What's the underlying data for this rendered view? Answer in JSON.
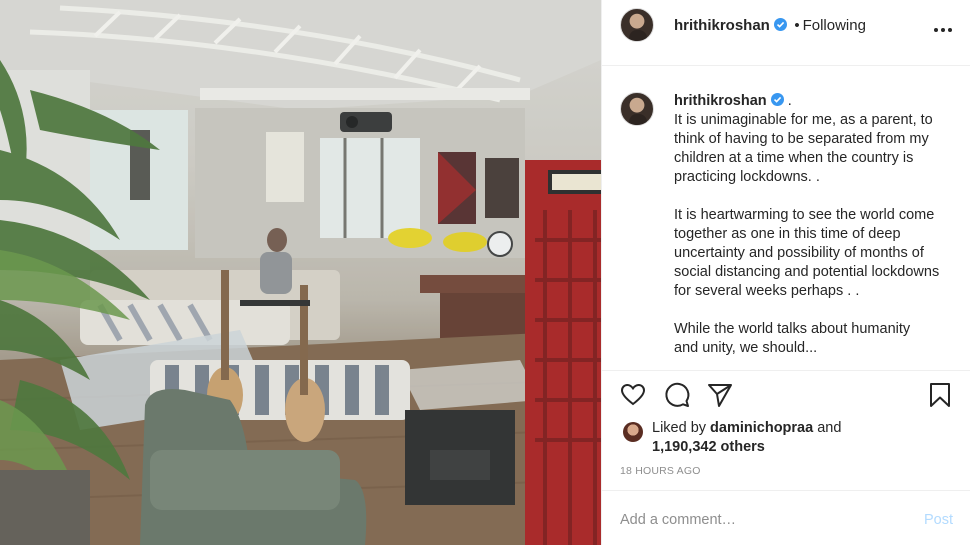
{
  "post": {
    "username": "hrithikroshan",
    "follow_status": "Following",
    "separator": "•",
    "more_icon": "more-horizontal-icon",
    "verified_icon": "verified-badge-icon"
  },
  "caption": {
    "username": "hrithikroshan",
    "suffix": ".",
    "text": "It is unimaginable for me, as a parent, to think of having to be separated from my children at a time when the country is practicing lockdowns. .\n\nIt is heartwarming to see the world come together as one in this time of deep uncertainty and possibility of months of social distancing and potential lockdowns for several weeks perhaps . .\n\nWhile the world talks about humanity",
    "text_cut": "and unity, we should..."
  },
  "actions": {
    "like_icon": "heart-icon",
    "comment_icon": "comment-icon",
    "share_icon": "paper-plane-icon",
    "save_icon": "bookmark-icon"
  },
  "likes": {
    "prefix": "Liked by",
    "user": "daminichopraa",
    "conj": "and",
    "count": "1,190,342 others"
  },
  "timestamp": "18 HOURS AGO",
  "comment_box": {
    "placeholder": "Add a comment…",
    "post_label": "Post"
  },
  "colors": {
    "verified": "#3897f0",
    "post_disabled": "#b3dbff",
    "muted": "#8e8e8e",
    "phone_booth_red": "#b31b1b"
  }
}
